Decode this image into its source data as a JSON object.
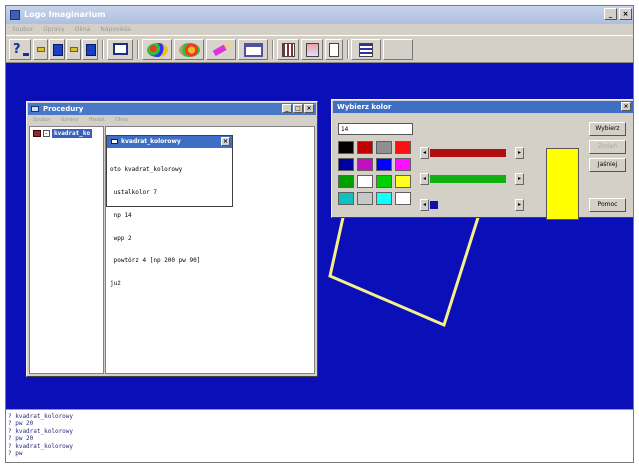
{
  "app": {
    "title": "Logo Imaginarium"
  },
  "menu": [
    "Soubor",
    "Úpravy",
    "Okna",
    "Nápověda"
  ],
  "toolbar_icons": [
    "help-icon",
    "green-arrow-icon",
    "blue-book-icon",
    "green-arrow-icon",
    "screen-icon",
    "paint-icon",
    "palette-icon",
    "pencil-icon",
    "window-icon",
    "column-icon",
    "image-icon",
    "page-icon",
    "blank-icon"
  ],
  "procedures_window": {
    "title": "Procedury",
    "menu": [
      "Soubor",
      "Úpravy",
      "Hledat",
      "Okna"
    ],
    "tree_item": "kvadrat_ko",
    "editor_title": "kvadrat_kolorowy",
    "code_lines": [
      "oto kvadrat_kolorowy",
      " ustalkolor 7",
      " np 14",
      " wpp 2",
      " powtórz 4 [np 200 pw 90]",
      "już"
    ]
  },
  "color_dialog": {
    "title": "Wybierz kolor",
    "value": "14",
    "palette": [
      "#000000",
      "#c00000",
      "#8f8f8f",
      "#ff1010",
      "#0000a0",
      "#c010c0",
      "#0000ff",
      "#ff10ff",
      "#00a000",
      "#ffffff",
      "#00d000",
      "#ffff20",
      "#10c0c0",
      "#c8c8c8",
      "#10ffff",
      "#ffffff"
    ],
    "rgb_colors": [
      "#b01010",
      "#10b010",
      "#1010b0"
    ],
    "rgb_levels": [
      0.9,
      0.9,
      0.1
    ],
    "preview_color": "#ffff00",
    "buttons": {
      "ok": "Wybierz",
      "apply": "Zmień",
      "invert": "Jaśniej",
      "help": "Pomoc"
    }
  },
  "canvas": {
    "background": "#0b0fb8",
    "line_color": "#f5f08a"
  },
  "console_lines": [
    "? kvadrat_kolorowy",
    "? pw 20",
    "? kvadrat_kolorowy",
    "? pw 20",
    "? kvadrat_kolorowy",
    "? pw"
  ]
}
